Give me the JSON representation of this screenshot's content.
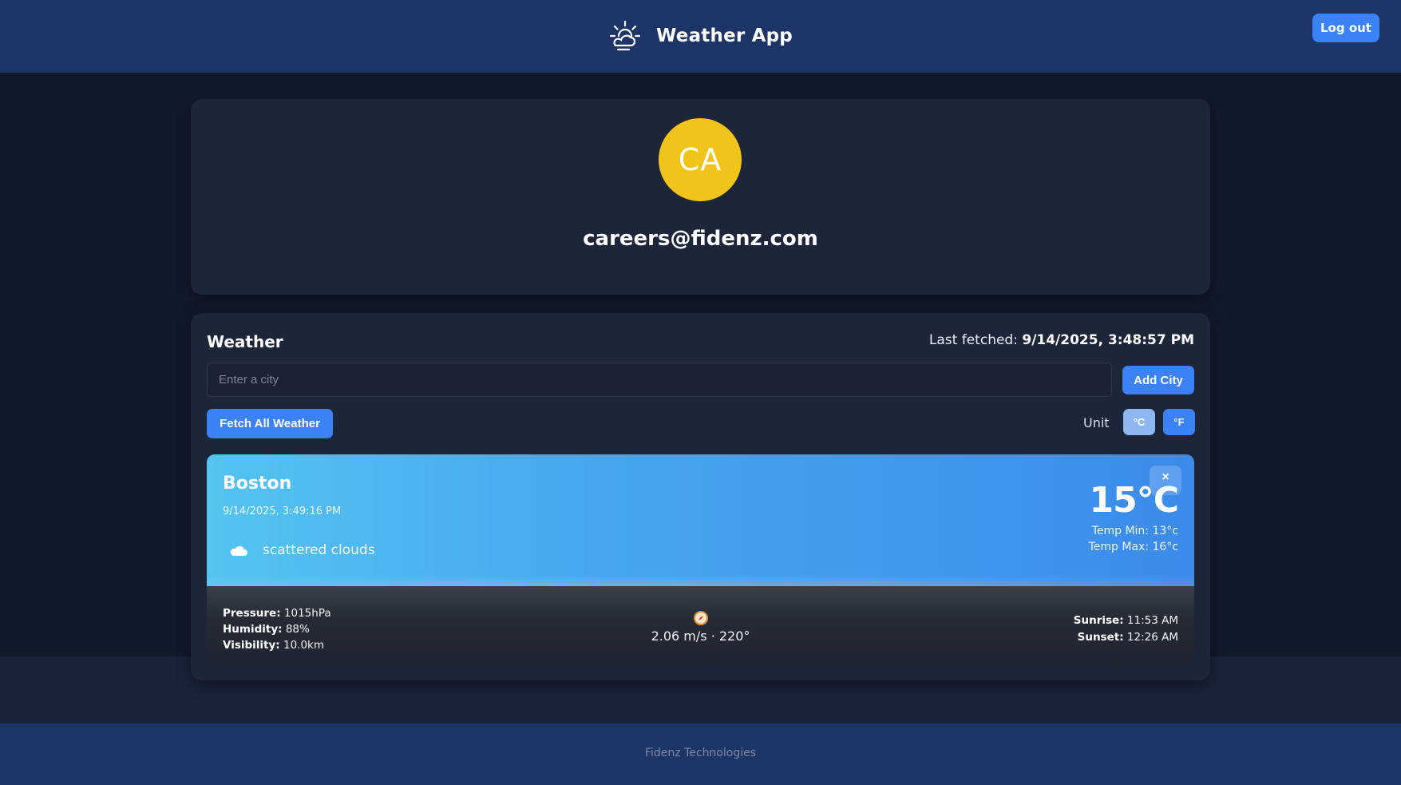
{
  "header": {
    "title": "Weather App",
    "logout_label": "Log out"
  },
  "profile": {
    "initials": "CA",
    "email": "careers@fidenz.com",
    "avatar_color": "#f0c419"
  },
  "weather": {
    "title": "Weather",
    "last_fetched_label": "Last fetched:",
    "last_fetched_value": "9/14/2025, 3:48:57 PM",
    "city_input_placeholder": "Enter a city",
    "add_city_label": "Add City",
    "fetch_all_label": "Fetch All Weather",
    "unit_label": "Unit",
    "unit_c_label": "°C",
    "unit_f_label": "°F",
    "selected_unit": "°C"
  },
  "city_card": {
    "name": "Boston",
    "datetime": "9/14/2025, 3:49:16 PM",
    "condition": "scattered clouds",
    "condition_icon": "cloud-icon",
    "temperature": "15°C",
    "temp_min_label": "Temp Min:",
    "temp_min_value": "13°c",
    "temp_max_label": "Temp Max:",
    "temp_max_value": "16°c",
    "close_label": "×",
    "pressure_label": "Pressure:",
    "pressure_value": "1015hPa",
    "humidity_label": "Humidity:",
    "humidity_value": "88%",
    "visibility_label": "Visibility:",
    "visibility_value": "10.0km",
    "wind_icon": "compass-icon",
    "wind": "2.06 m/s · 220°",
    "sunrise_label": "Sunrise:",
    "sunrise_value": "11:53 AM",
    "sunset_label": "Sunset:",
    "sunset_value": "12:26 AM"
  },
  "footer": {
    "text": "Fidenz Technologies"
  },
  "colors": {
    "header_bg": "#1c3566",
    "page_bg": "#111a2c",
    "card_bg": "#1d2639",
    "accent": "#3b82f6",
    "unit_selected": "#8fb8f2"
  }
}
